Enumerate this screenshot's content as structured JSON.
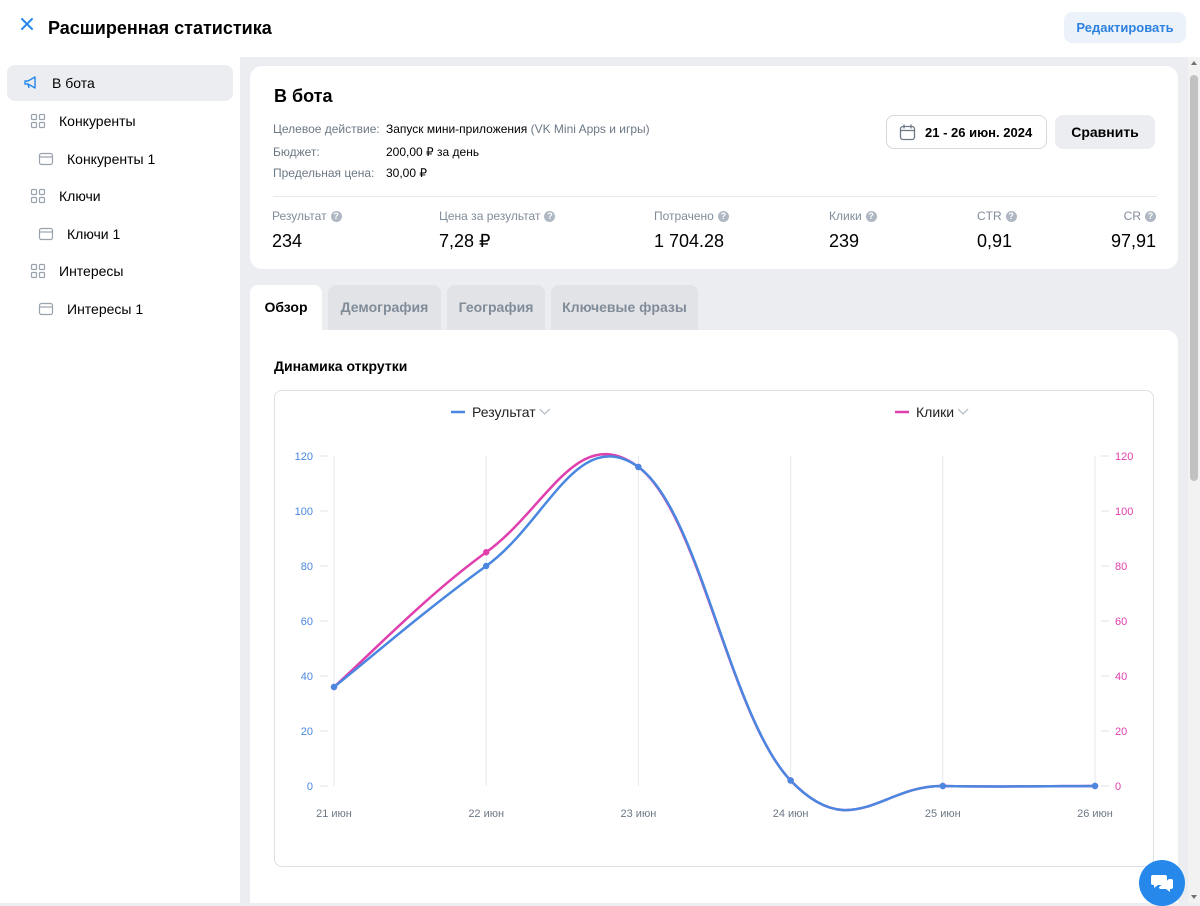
{
  "header": {
    "title": "Расширенная статистика",
    "edit_label": "Редактировать"
  },
  "sidebar": {
    "items": [
      {
        "label": "В бота",
        "icon": "megaphone-icon",
        "active": true
      },
      {
        "label": "Конкуренты",
        "icon": "grid-icon"
      },
      {
        "label": "Конкуренты 1",
        "icon": "window-icon"
      },
      {
        "label": "Ключи",
        "icon": "grid-icon"
      },
      {
        "label": "Ключи 1",
        "icon": "window-icon"
      },
      {
        "label": "Интересы",
        "icon": "grid-icon"
      },
      {
        "label": "Интересы 1",
        "icon": "window-icon"
      }
    ]
  },
  "card": {
    "title": "В бота",
    "target_label": "Целевое действие:",
    "target_value": "Запуск мини-приложения",
    "target_extra": " (VK Mini Apps и игры)",
    "budget_label": "Бюджет:",
    "budget_value": "200,00 ₽ за день",
    "price_label": "Предельная цена:",
    "price_value": "30,00 ₽",
    "date_range": "21 - 26 июн. 2024",
    "compare_label": "Сравнить",
    "metrics": [
      {
        "label": "Результат",
        "value": "234"
      },
      {
        "label": "Цена за результат",
        "value": "7,28 ₽"
      },
      {
        "label": "Потрачено",
        "value": "1 704.28"
      },
      {
        "label": "Клики",
        "value": "239"
      },
      {
        "label": "CTR",
        "value": "0,91"
      },
      {
        "label": "CR",
        "value": "97,91"
      }
    ]
  },
  "tabs": [
    "Обзор",
    "Демография",
    "География",
    "Ключевые фразы"
  ],
  "panel": {
    "title": "Динамика открутки"
  },
  "chart_data": {
    "type": "line",
    "x": [
      "21 июн",
      "22 июн",
      "23 июн",
      "24 июн",
      "25 июн",
      "26 июн"
    ],
    "series": [
      {
        "name": "Результат",
        "color": "#4a87e0",
        "values": [
          36,
          80,
          116,
          2,
          0,
          0
        ]
      },
      {
        "name": "Клики",
        "color": "#e03fae",
        "values": [
          36,
          85,
          116,
          2,
          0,
          0
        ]
      }
    ],
    "y_left": {
      "ticks": [
        0,
        20,
        40,
        60,
        80,
        100,
        120
      ],
      "range": [
        0,
        120
      ],
      "color": "#4a87e0"
    },
    "y_right": {
      "ticks": [
        0,
        20,
        40,
        60,
        80,
        100,
        120
      ],
      "range": [
        0,
        120
      ],
      "color": "#e03fae"
    },
    "grid": "vertical",
    "legend": "top"
  },
  "colors": {
    "accent": "#2688eb",
    "result_line": "#4a87e0",
    "clicks_line": "#e03fae"
  }
}
